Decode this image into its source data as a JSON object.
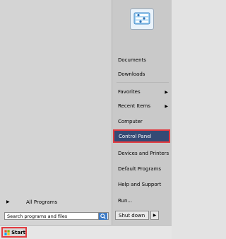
{
  "left_pane": {
    "all_programs_label": "All Programs",
    "search_placeholder": "Search programs and files"
  },
  "right_pane": {
    "items": [
      {
        "label": "Documents"
      },
      {
        "label": "Downloads"
      },
      {
        "label": "Favorites"
      },
      {
        "label": "Recent Items"
      },
      {
        "label": "Computer"
      },
      {
        "label": "Control Panel"
      },
      {
        "label": "Devices and Printers"
      },
      {
        "label": "Default Programs"
      },
      {
        "label": "Help and Support"
      },
      {
        "label": "Run..."
      }
    ],
    "shutdown_label": "Shut down"
  },
  "taskbar": {
    "start_label": "Start"
  },
  "colors": {
    "highlight_border": "#e23a3f",
    "selected_bg": "#344a75"
  }
}
